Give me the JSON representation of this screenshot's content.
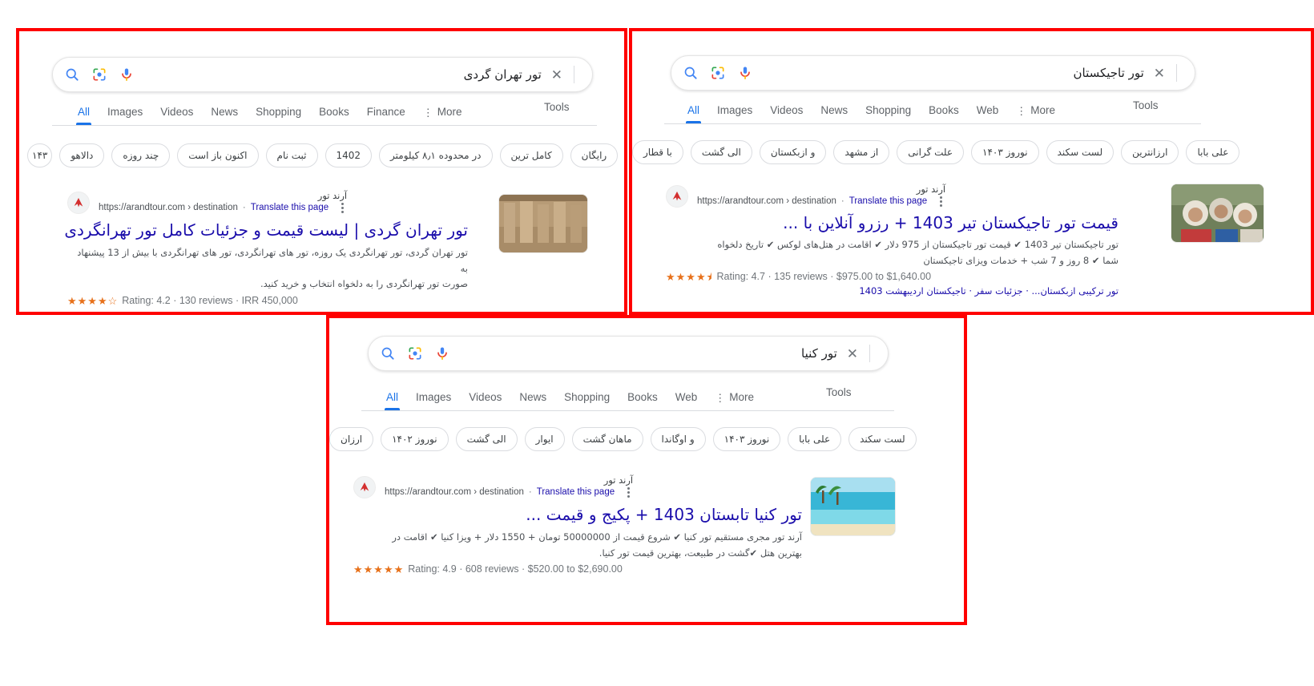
{
  "panels": [
    {
      "id": "panel-tehran",
      "search": {
        "query": "تور تهران گردی",
        "clear_label": "✕",
        "icons": [
          "mic-icon",
          "google-lens-icon",
          "search-icon"
        ]
      },
      "nav": {
        "tabs": [
          "All",
          "Images",
          "Videos",
          "News",
          "Shopping",
          "Books",
          "Finance",
          "More"
        ],
        "active": "All",
        "tools_label": "Tools"
      },
      "chips": [
        "۱۴۳",
        "دالاهو",
        "چند روزه",
        "اکنون باز است",
        "ثبت نام",
        "1402",
        "در محدوده ۸٫۱ کیلومتر",
        "کامل ترین",
        "رایگان"
      ],
      "result": {
        "site_name": "آرند تور",
        "url": "https://arandtour.com › destination",
        "translate_label": "Translate this page",
        "title": "تور تهران گردی | لیست قیمت و جزئیات کامل تور تهرانگردی",
        "snippet_line1": "تور تهران گردی، تور تهرانگردی یک روزه، تور های تهرانگردی، تور های تهرانگردی با بیش از 13 پیشنهاد به",
        "snippet_line2": "صورت تور تهرانگردی را به دلخواه انتخاب و خرید کنید.",
        "rating_stars": "★★★★☆",
        "rating_text": "Rating: 4.2 · 130 reviews · IRR 450,000",
        "thumbnail_alt": "persepolis-relief-thumbnail"
      }
    },
    {
      "id": "panel-tajikistan",
      "search": {
        "query": "تور تاجیکستان",
        "clear_label": "✕",
        "icons": [
          "mic-icon",
          "google-lens-icon",
          "search-icon"
        ]
      },
      "nav": {
        "tabs": [
          "All",
          "Images",
          "Videos",
          "News",
          "Shopping",
          "Books",
          "Web",
          "More"
        ],
        "active": "All",
        "tools_label": "Tools"
      },
      "chips": [
        "با قطار",
        "الی گشت",
        "و ازبکستان",
        "از مشهد",
        "علت گرانی",
        "نوروز ۱۴۰۳",
        "لست سکند",
        "ارزانترین",
        "علی بابا"
      ],
      "result": {
        "site_name": "آرند تور",
        "url": "https://arandtour.com › destination",
        "translate_label": "Translate this page",
        "title": "قیمت تور تاجیکستان تیر 1403 + رزرو آنلاین با ...",
        "snippet_line1": "تور تاجیکستان تیر 1403 ✔ قیمت تور تاجیکستان از 975 دلار ✔ اقامت در هتل‌های لوکس ✔ تاریخ دلخواه",
        "snippet_line2": "شما ✔ 8 روز و 7 شب + خدمات ویزای تاجیکستان",
        "rating_stars": "★★★★⯨",
        "rating_text": "Rating: 4.7 · 135 reviews · $975.00 to $1,640.00",
        "sitelinks": "تور ترکیبی ازبکستان... · جزئیات سفر · تاجیکستان اردیبهشت 1403",
        "thumbnail_alt": "tajik-women-portrait-thumbnail"
      }
    },
    {
      "id": "panel-kenya",
      "search": {
        "query": "تور کنیا",
        "clear_label": "✕",
        "icons": [
          "mic-icon",
          "google-lens-icon",
          "search-icon"
        ]
      },
      "nav": {
        "tabs": [
          "All",
          "Images",
          "Videos",
          "News",
          "Shopping",
          "Books",
          "Web",
          "More"
        ],
        "active": "All",
        "tools_label": "Tools"
      },
      "chips": [
        "ارزان",
        "نوروز ۱۴۰۲",
        "الی گشت",
        "ایوار",
        "ماهان گشت",
        "و اوگاندا",
        "نوروز ۱۴۰۳",
        "علی بابا",
        "لست سکند"
      ],
      "result": {
        "site_name": "آرند تور",
        "url": "https://arandtour.com › destination",
        "translate_label": "Translate this page",
        "title": "تور کنیا تابستان 1403 + پکیج و قیمت ...",
        "snippet_line1": "آرند تور مجری مستقیم تور کنیا ✔ شروع قیمت از 50000000 تومان + 1550 دلار + ویزا کنیا ✔ اقامت در",
        "snippet_line2": "بهترین هتل ✔گشت در طبیعت، بهترین قیمت تور کنیا.",
        "rating_stars": "★★★★★",
        "rating_text": "Rating: 4.9 · 608 reviews · $520.00 to $2,690.00",
        "thumbnail_alt": "tropical-beach-thumbnail"
      }
    }
  ],
  "colors": {
    "accent_blue": "#1a73e8",
    "link_blue": "#1a0dab",
    "annotation_red": "#ff0000",
    "star_orange": "#e7711b",
    "check_green": "#0f9d58"
  }
}
